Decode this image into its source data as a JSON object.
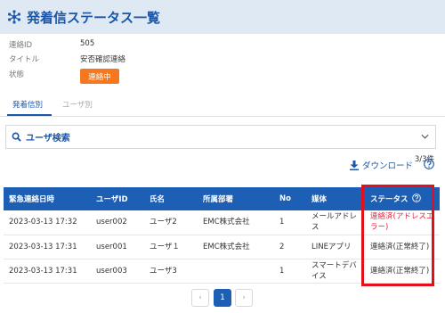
{
  "page": {
    "title": "発着信ステータス一覧"
  },
  "info": {
    "id_label": "連絡ID",
    "id_value": "505",
    "title_label": "タイトル",
    "title_value": "安否確認連絡",
    "state_label": "状態",
    "state_value": "連絡中"
  },
  "tabs": [
    {
      "label": "発着信別",
      "active": true
    },
    {
      "label": "ユーザ別",
      "active": false
    }
  ],
  "search": {
    "title": "ユーザ検索"
  },
  "result_count": "3/3件",
  "download_label": "ダウンロード",
  "table": {
    "headers": [
      "緊急連絡日時",
      "ユーザID",
      "氏名",
      "所属部署",
      "No",
      "媒体",
      "ステータス"
    ],
    "rows": [
      [
        "2023-03-13 17:32",
        "user002",
        "ユーザ2",
        "EMC株式会社",
        "1",
        "メールアドレス",
        "連絡済(アドレスエラー)"
      ],
      [
        "2023-03-13 17:31",
        "user001",
        "ユーザ１",
        "EMC株式会社",
        "2",
        "LINEアプリ",
        "連絡済(正常終了)"
      ],
      [
        "2023-03-13 17:31",
        "user003",
        "ユーザ3",
        "",
        "1",
        "スマートデバイス",
        "連絡済(正常終了)"
      ]
    ]
  },
  "pagination": {
    "prev": "‹",
    "current": "1",
    "next": "›"
  },
  "colors": {
    "accent": "#1c56a8",
    "header_bg": "#dfe9f4",
    "table_header": "#1d5fb4",
    "status_badge": "#f5781f",
    "error_text": "#e0263e",
    "highlight": "#e3101c"
  }
}
